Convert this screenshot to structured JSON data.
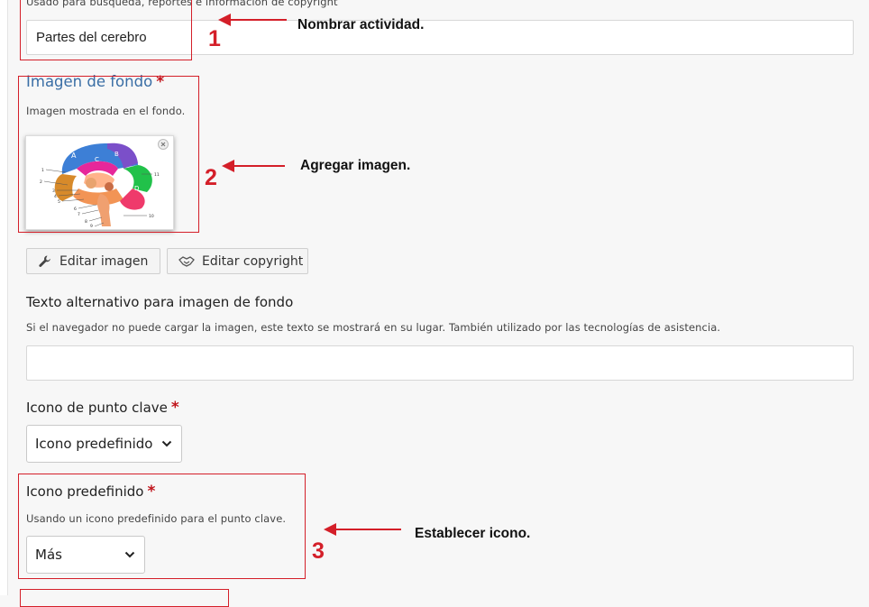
{
  "title_field": {
    "description": "Usado para búsqueda, reportes e información de copyright",
    "value": "Partes del cerebro"
  },
  "background_image": {
    "label": "Imagen de fondo",
    "required_mark": "*",
    "description": "Imagen mostrada en el fondo.",
    "edit_image_label": "Editar imagen",
    "edit_copyright_label": "Editar copyright",
    "thumb_lobe_labels": [
      "A",
      "C",
      "B",
      "D"
    ],
    "thumb_side_numbers": [
      "1",
      "2",
      "3",
      "4",
      "5",
      "6",
      "7",
      "8",
      "9",
      "10",
      "11"
    ]
  },
  "alt_text": {
    "label": "Texto alternativo para imagen de fondo",
    "description": "Si el navegador no puede cargar la imagen, este texto se mostrará en su lugar. También utilizado por las tecnologías de asistencia.",
    "value": ""
  },
  "hotspot_icon": {
    "label": "Icono de punto clave",
    "required_mark": "*",
    "selected": "Icono predefinido"
  },
  "predefined_icon": {
    "label": "Icono predefinido",
    "required_mark": "*",
    "description": "Usando un icono predefinido para el punto clave.",
    "selected": "Más"
  },
  "annotations": [
    {
      "number": "1",
      "text": "Nombrar actividad."
    },
    {
      "number": "2",
      "text": "Agregar imagen."
    },
    {
      "number": "3",
      "text": "Establecer icono."
    }
  ],
  "colors": {
    "accent_title": "#3a6ea5",
    "annotation_red": "#d41f29",
    "required_red": "#c0141b"
  }
}
